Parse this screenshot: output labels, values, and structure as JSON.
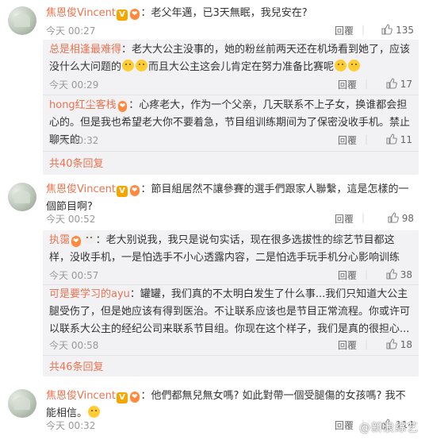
{
  "comments": [
    {
      "username": "焦恩俊Vincent",
      "text": "：老父年邁，已3天無眠，我兒安在?",
      "time": "今天 00:27",
      "reply_label": "回覆",
      "likes": "135"
    },
    {
      "username": "焦恩俊Vincent",
      "text": "：節目組居然不讓參賽的選手們跟家人聯繫，這是怎樣的一個節目啊?",
      "time": "今天 00:52",
      "reply_label": "回覆",
      "likes": "98"
    },
    {
      "username": "焦恩俊Vincent",
      "text": "：他們都無兒無女嗎? 如此對帶一個受腿傷的女孩嗎? 我不能相信。",
      "time": "今天 00:32",
      "reply_label": "回覆",
      "likes": "114"
    }
  ],
  "replies_1": [
    {
      "username": "总是相逢最难得",
      "text": "：老大大公主没事的，她的粉丝前两天还在机场看到她了，应该没什么大问题的",
      "text2": "而且大公主这会儿肯定在努力准备比赛呢",
      "time": "今天 00:29",
      "reply_label": "回覆",
      "likes": "17"
    },
    {
      "username": "hong红尘客栈",
      "text": "：心疼老大，作为一个父亲，几天联系不上子女，换谁都会担心的。但是我也希望老大你不要着急，节目组训练期间为了保密没收手机。禁止聊天的",
      "time": "今天 00:32",
      "reply_label": "回覆",
      "likes": "11"
    }
  ],
  "more_1": "共40条回复",
  "replies_2": [
    {
      "username": "执霭",
      "text": "：老大别说我，我只是说句实话，现在很多选拔性的综艺节目都这样，没收手机，一是怕选手不小心透露内容，二是怕选手玩手机分心影响训练",
      "time": "今天 00:57",
      "reply_label": "回覆",
      "likes": "38"
    },
    {
      "username": "可是要学习的ayu",
      "text": "：罐罐，我们真的不太明白发生了什么事...我们只知道大公主腿受伤了，但是她应该有得到医治。不让联系应该也是节目正常流程。你或许可以联系大公主的经纪公司来联系节目组。你现在这个样子，我们是真的很担心...",
      "time": "今天 00:58",
      "reply_label": "回覆",
      "likes": "18"
    }
  ],
  "more_2": "共46条回复",
  "watermark": "@新浪综艺"
}
